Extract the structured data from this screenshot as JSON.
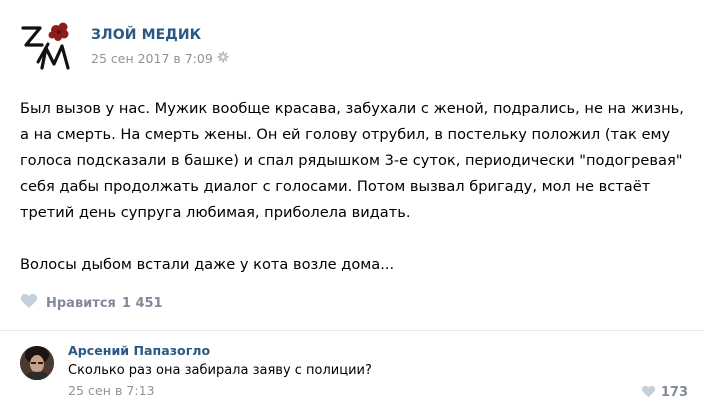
{
  "post": {
    "author": "ЗЛОЙ МЕДИК",
    "date": "25 сен 2017 в 7:09",
    "paragraphs": [
      "Был вызов у нас. Мужик вообще красава, забухали с женой, подрались, не на жизнь, а на смерть. На смерть жены. Он ей голову отрубил, в постельку положил (так ему голоса подсказали в башке) и спал рядышком 3-е суток, периодически \"подогревая\" себя дабы продолжать диалог с голосами. Потом вызвал бригаду, мол не встаёт третий день супруга любимая, приболела видать.",
      "Волосы дыбом встали даже у кота возле дома..."
    ],
    "likes_label": "Нравится",
    "likes_count": "1 451"
  },
  "comment": {
    "author": "Арсений Папазогло",
    "text": "Сколько раз она забирала заяву с полиции?",
    "date": "25 сен в 7:13",
    "likes_count": "173"
  },
  "colors": {
    "link": "#2a5885",
    "muted": "#939393",
    "like_icon": "#c5d0db",
    "logo_red": "#8e1c1c"
  },
  "icons": {
    "logo": "zlm-logo-with-red-flower",
    "settings": "gear-icon",
    "like": "heart-icon"
  }
}
